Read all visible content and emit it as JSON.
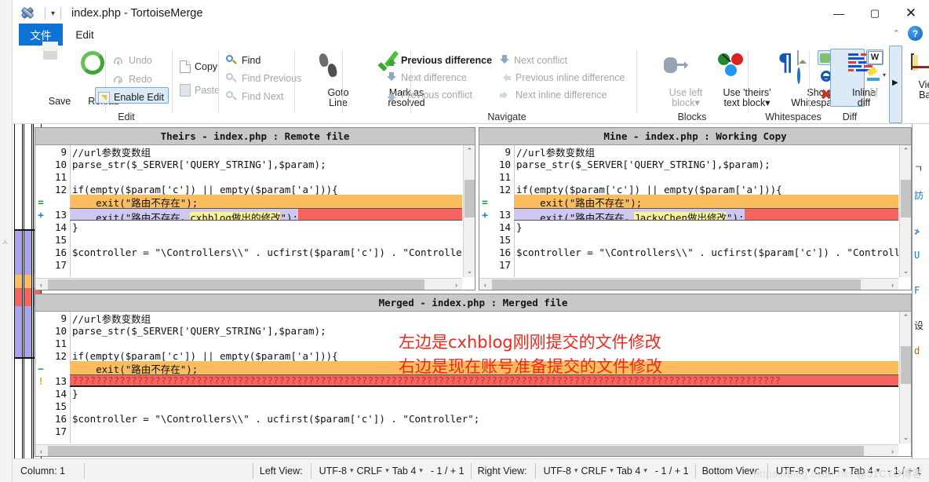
{
  "window": {
    "title": "index.php - TortoiseMerge",
    "app_icon": "tortoisemerge-icon",
    "quick_access_caret": "▾",
    "minimize": "—",
    "maximize": "▢",
    "close": "✕",
    "collapse_ribbon": "⌃",
    "help": "?"
  },
  "tabs": [
    {
      "label": "文件",
      "active": true
    },
    {
      "label": "Edit",
      "active": false
    }
  ],
  "ribbon": {
    "groups": [
      {
        "name": "Edit",
        "label": "Edit",
        "big_buttons": [
          {
            "label": "Save",
            "icon": "floppy-disk-icon",
            "enabled": true
          },
          {
            "label": "Reload",
            "icon": "reload-circular-arrows-icon",
            "enabled": true
          }
        ],
        "small_buttons": [
          {
            "label": "Undo",
            "icon": "undo-arrow-icon",
            "enabled": false
          },
          {
            "label": "Redo",
            "icon": "redo-arrow-icon",
            "enabled": false
          },
          {
            "label": "Enable Edit",
            "icon": "enable-edit-icon",
            "enabled": true,
            "highlighted": true
          },
          {
            "label": "Copy",
            "icon": "copy-page-icon",
            "enabled": true
          },
          {
            "label": "Paste",
            "icon": "paste-clipboard-icon",
            "enabled": false
          },
          {
            "label": "Find",
            "icon": "magnifier-icon",
            "enabled": true
          },
          {
            "label": "Find Previous",
            "icon": "magnifier-icon",
            "enabled": false
          },
          {
            "label": "Find Next",
            "icon": "magnifier-icon",
            "enabled": false
          }
        ],
        "goto_line": {
          "label_line1": "Goto",
          "label_line2": "Line",
          "icon": "footprints-icon"
        },
        "mark_resolved": {
          "label_line1": "Mark as",
          "label_line2": "resolved",
          "icon": "green-check-icon"
        }
      },
      {
        "name": "Navigate",
        "label": "Navigate",
        "items": [
          {
            "label": "Previous difference",
            "icon": "arrow-up-green-icon",
            "enabled": true
          },
          {
            "label": "Next difference",
            "icon": "arrow-down-blue-icon",
            "enabled": false
          },
          {
            "label": "Previous conflict",
            "icon": "arrow-up-gray-icon",
            "enabled": false
          },
          {
            "label": "Next conflict",
            "icon": "arrow-down-blue-icon",
            "enabled": false
          },
          {
            "label": "Previous inline difference",
            "icon": "arrow-left-inline-icon",
            "enabled": false
          },
          {
            "label": "Next inline difference",
            "icon": "arrow-right-inline-icon",
            "enabled": false
          }
        ]
      },
      {
        "name": "Blocks",
        "label": "Blocks",
        "buttons": [
          {
            "label_line1": "Use left",
            "label_line2": "block",
            "icon": "use-left-block-icon",
            "enabled": false,
            "dropdown": "▾"
          },
          {
            "label_line1": "Use 'theirs'",
            "label_line2": "text block",
            "icon": "use-theirs-block-icon",
            "enabled": true,
            "dropdown": "▾"
          }
        ]
      },
      {
        "name": "Whitespaces",
        "label": "Whitespaces",
        "buttons": [
          {
            "label_line1": "Show",
            "label_line2": "Whitespaces",
            "icon": "pilcrow-icon",
            "enabled": true
          }
        ],
        "toggles": [
          {
            "icon": "ignore-whitespace-check-icon",
            "selected": true
          },
          {
            "icon": "ignore-whitespace-changes-icon",
            "selected": false
          },
          {
            "icon": "compare-whitespaces-icon",
            "selected": false
          }
        ]
      },
      {
        "name": "Diff",
        "label": "Diff",
        "buttons": [
          {
            "label_line1": "Inline",
            "label_line2": "diff",
            "icon": "inline-diff-icon",
            "selected": true
          }
        ],
        "toggles": [
          {
            "icon": "word-diff-icon",
            "selected": true
          },
          {
            "icon": "highlighter-pen-icon",
            "selected": false,
            "dropdown": "▾"
          },
          {
            "icon": "hide-unchanged-icon",
            "selected": false
          }
        ],
        "side_icons": [
          {
            "icon": "image-diff-icon"
          },
          {
            "icon": "globe-encoding-icon"
          }
        ]
      },
      {
        "name": "View",
        "buttons": [
          {
            "label_line1": "View",
            "label_line2": "Bars",
            "icon": "view-bars-icon"
          }
        ],
        "overflow": "▶"
      }
    ]
  },
  "locator_bars": {
    "count": 3,
    "segments": [
      {
        "color": "#a9a3ef",
        "top": 0.555,
        "height": 0.133
      },
      {
        "color": "#fbbd5e",
        "top": 0.688,
        "height": 0.038
      },
      {
        "color": "#f6645f",
        "top": 0.726,
        "height": 0.052
      },
      {
        "color": "#a9a3ef",
        "top": 0.778,
        "height": 0.15
      }
    ]
  },
  "panes": {
    "left": {
      "title": "Theirs - index.php : Remote file",
      "lines": [
        {
          "marker": "",
          "num": "9",
          "text": "//url参数变数组",
          "style": "normal"
        },
        {
          "marker": "",
          "num": "10",
          "text": "parse_str($_SERVER['QUERY_STRING'],$param);",
          "style": "normal"
        },
        {
          "marker": "",
          "num": "11",
          "text": "",
          "style": "normal"
        },
        {
          "marker": "",
          "num": "12",
          "text": "if(empty($param['c']) || empty($param['a'])){",
          "style": "normal"
        },
        {
          "marker": "=",
          "num": "",
          "text": "    exit(\"路由不存在\");",
          "style": "orange"
        },
        {
          "marker": "+",
          "num": "13",
          "pre": "    exit(\"路由不存在，",
          "hl": "cxhblog做出的修改",
          "post": "\");",
          "style": "lilac-conflict"
        },
        {
          "marker": "",
          "num": "14",
          "text": "}",
          "style": "normal"
        },
        {
          "marker": "",
          "num": "15",
          "text": "",
          "style": "normal"
        },
        {
          "marker": "",
          "num": "16",
          "text": "$controller = \"\\Controllers\\\\\" . ucfirst($param['c']) . \"Controller\";",
          "style": "normal"
        },
        {
          "marker": "",
          "num": "17",
          "text": "",
          "style": "normal"
        }
      ]
    },
    "right": {
      "title": "Mine - index.php : Working Copy",
      "lines": [
        {
          "marker": "",
          "num": "9",
          "text": "//url参数变数组",
          "style": "normal"
        },
        {
          "marker": "",
          "num": "10",
          "text": "parse_str($_SERVER['QUERY_STRING'],$param);",
          "style": "normal"
        },
        {
          "marker": "",
          "num": "11",
          "text": "",
          "style": "normal"
        },
        {
          "marker": "",
          "num": "12",
          "text": "if(empty($param['c']) || empty($param['a'])){",
          "style": "normal"
        },
        {
          "marker": "=",
          "num": "",
          "text": "    exit(\"路由不存在\");",
          "style": "orange"
        },
        {
          "marker": "+",
          "num": "13",
          "pre": "    exit(\"路由不存在，",
          "hl": "JackyChen做出修改",
          "post": "\");",
          "style": "lilac-conflict"
        },
        {
          "marker": "",
          "num": "14",
          "text": "}",
          "style": "normal"
        },
        {
          "marker": "",
          "num": "15",
          "text": "",
          "style": "normal"
        },
        {
          "marker": "",
          "num": "16",
          "text": "$controller = \"\\Controllers\\\\\" . ucfirst($param['c']) . \"Controller\";",
          "style": "normal"
        },
        {
          "marker": "",
          "num": "17",
          "text": "",
          "style": "normal"
        }
      ]
    },
    "merged": {
      "title": "Merged - index.php : Merged file",
      "lines": [
        {
          "marker": "",
          "num": "9",
          "text": "//url参数变数组",
          "style": "normal"
        },
        {
          "marker": "",
          "num": "10",
          "text": "parse_str($_SERVER['QUERY_STRING'],$param);",
          "style": "normal"
        },
        {
          "marker": "",
          "num": "11",
          "text": "",
          "style": "normal"
        },
        {
          "marker": "",
          "num": "12",
          "text": "if(empty($param['c']) || empty($param['a'])){",
          "style": "normal"
        },
        {
          "marker": "−",
          "num": "",
          "text": "    exit(\"路由不存在\");",
          "style": "orange"
        },
        {
          "marker": "!",
          "num": "13",
          "text": "????????????????????????????????????????????????????????????????????????????????????????????????????????????????????????",
          "style": "conflict"
        },
        {
          "marker": "",
          "num": "14",
          "text": "}",
          "style": "normal"
        },
        {
          "marker": "",
          "num": "15",
          "text": "",
          "style": "normal"
        },
        {
          "marker": "",
          "num": "16",
          "text": "$controller = \"\\Controllers\\\\\" . ucfirst($param['c']) . \"Controller\";",
          "style": "normal"
        },
        {
          "marker": "",
          "num": "17",
          "text": "",
          "style": "normal"
        }
      ]
    }
  },
  "annotations": [
    {
      "text": "左边是cxhblog刚刚提交的文件修改",
      "color": "#f0271d"
    },
    {
      "text": "右边是现在账号准备提交的文件修改",
      "color": "#f0271d"
    }
  ],
  "statusbar": {
    "column": "Column: 1",
    "views": [
      {
        "label": "Left View:",
        "encoding": "UTF-8",
        "eol": "CRLF",
        "tab": "Tab 4",
        "counts": "- 1 / + 1"
      },
      {
        "label": "Right View:",
        "encoding": "UTF-8",
        "eol": "CRLF",
        "tab": "Tab 4",
        "counts": "- 1 / + 1"
      },
      {
        "label": "Bottom View:",
        "encoding": "UTF-8",
        "eol": "CRLF",
        "tab": "Tab 4",
        "counts": "- 1 / + 1"
      }
    ],
    "caret": "▾"
  },
  "watermark": {
    "url": "https://blog.csdn.net",
    "name": "@51CTO博客"
  },
  "colors": {
    "accent": "#0b74d4",
    "orange_diff": "#fbbd5e",
    "lilac_diff": "#cdc9f3",
    "conflict_red": "#f6645f",
    "inline_hl": "#fbf39a",
    "annotation_red": "#f0271d",
    "header_gray": "#c8c8c8"
  }
}
